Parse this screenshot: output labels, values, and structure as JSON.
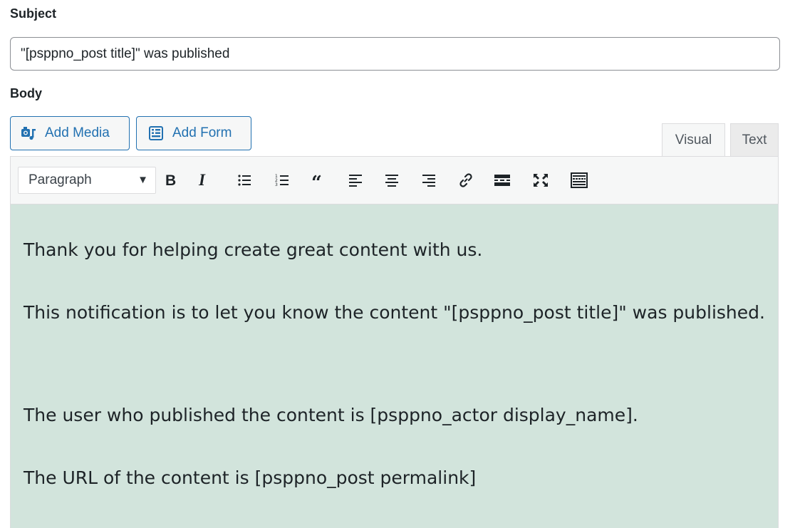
{
  "subject": {
    "label": "Subject",
    "value": "\"[psppno_post title]\" was published"
  },
  "body": {
    "label": "Body"
  },
  "media_buttons": {
    "add_media": "Add Media",
    "add_form": "Add Form"
  },
  "tabs": {
    "visual": "Visual",
    "text": "Text",
    "active": "visual"
  },
  "toolbar": {
    "format_selected": "Paragraph",
    "buttons": [
      {
        "icon": "bold-icon"
      },
      {
        "icon": "italic-icon"
      },
      {
        "icon": "bulleted-list-icon"
      },
      {
        "icon": "numbered-list-icon"
      },
      {
        "icon": "blockquote-icon"
      },
      {
        "icon": "align-left-icon"
      },
      {
        "icon": "align-center-icon"
      },
      {
        "icon": "align-right-icon"
      },
      {
        "icon": "link-icon"
      },
      {
        "icon": "read-more-icon"
      },
      {
        "icon": "fullscreen-icon"
      },
      {
        "icon": "toolbar-toggle-icon"
      }
    ]
  },
  "editor": {
    "background": "#d2e4dc",
    "paragraphs": [
      "Thank you for helping create great content with us.",
      "This notification is to let you know the content \"[psppno_post title]\" was published.",
      "The user who published the content is [psppno_actor display_name].",
      "The URL of the content is [psppno_post permalink]"
    ]
  },
  "colors": {
    "accent": "#2271b1",
    "toolbar_bg": "#f6f7f7"
  }
}
